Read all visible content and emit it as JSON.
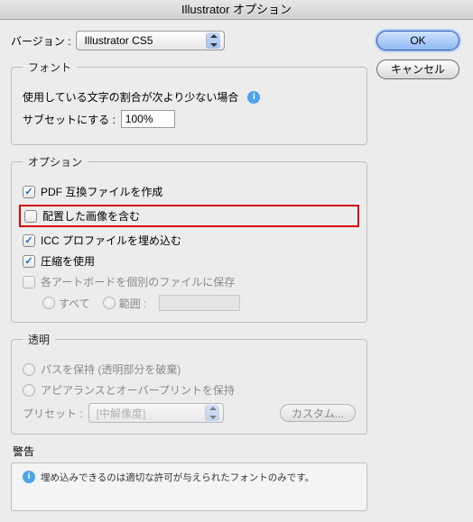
{
  "title": "Illustrator オプション",
  "buttons": {
    "ok": "OK",
    "cancel": "キャンセル"
  },
  "version": {
    "label": "バージョン :",
    "value": "Illustrator CS5"
  },
  "font": {
    "legend": "フォント",
    "line1": "使用している文字の割合が次より少ない場合",
    "subset_label": "サブセットにする :",
    "subset_value": "100%"
  },
  "options": {
    "legend": "オプション",
    "pdf": "PDF 互換ファイルを作成",
    "placed_images": "配置した画像を含む",
    "icc": "ICC プロファイルを埋め込む",
    "compress": "圧縮を使用",
    "artboards": "各アートボードを個別のファイルに保存",
    "all": "すべて",
    "range": "範囲 :"
  },
  "transparency": {
    "legend": "透明",
    "path": "パスを保持 (透明部分を破棄)",
    "appearance": "アピアランスとオーバープリントを保持",
    "preset_label": "プリセット :",
    "preset_value": "[中解像度]",
    "custom": "カスタム..."
  },
  "warning": {
    "label": "警告",
    "text": "埋め込みできるのは適切な許可が与えられたフォントのみです。"
  }
}
